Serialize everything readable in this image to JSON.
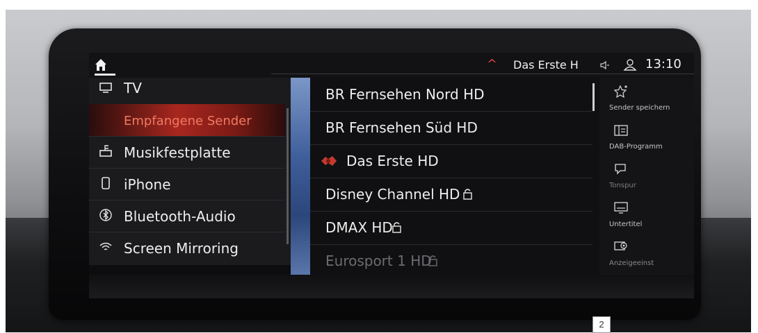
{
  "topbar": {
    "current_station": "Das Erste H",
    "time": "13:10"
  },
  "source_menu": {
    "items": [
      {
        "label": "TV",
        "icon": "tv-icon"
      },
      {
        "label": "Empfangene Sender",
        "icon": "",
        "active": true
      },
      {
        "label": "Musikfestplatte",
        "icon": "music-harddisk-icon"
      },
      {
        "label": "iPhone",
        "icon": "smartphone-icon"
      },
      {
        "label": "Bluetooth-Audio",
        "icon": "bluetooth-icon"
      },
      {
        "label": "Screen Mirroring",
        "icon": "wifi-icon"
      }
    ]
  },
  "channel_list": {
    "items": [
      {
        "label": "BR Fernsehen Nord HD"
      },
      {
        "label": "BR Fernsehen Süd HD"
      },
      {
        "label": "Das Erste HD",
        "playing": true
      },
      {
        "label": "Disney Channel HD",
        "locked": true
      },
      {
        "label": "DMAX HD",
        "locked": true
      },
      {
        "label": "Eurosport 1 HD",
        "locked": true
      }
    ]
  },
  "side_menu": {
    "items": [
      {
        "label": "Sender speichern",
        "icon": "star-plus-icon"
      },
      {
        "label": "DAB-Programm",
        "icon": "program-guide-icon"
      },
      {
        "label": "Tonspur",
        "icon": "audio-track-icon"
      },
      {
        "label": "Untertitel",
        "icon": "subtitles-icon"
      },
      {
        "label": "Anzeigeeinst",
        "icon": "display-settings-icon"
      }
    ]
  },
  "annotation": {
    "number": "2"
  },
  "colors": {
    "accent_red": "#e0443e",
    "active_item": "#a8271f",
    "text": "#eeeeee"
  }
}
